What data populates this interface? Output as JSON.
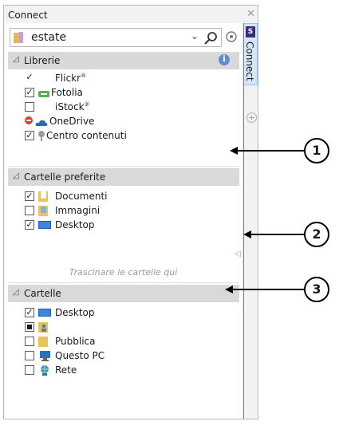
{
  "window": {
    "title": "Connect"
  },
  "search": {
    "value": "estate"
  },
  "sections": {
    "librerie": {
      "label": "Librerie",
      "items": [
        {
          "label": "Flickr",
          "sup": "®",
          "checked": true,
          "icon": "none"
        },
        {
          "label": "Fotolia",
          "sup": "",
          "checked": true,
          "icon": "fotolia-icon"
        },
        {
          "label": "iStock",
          "sup": "®",
          "checked": false,
          "icon": "none"
        },
        {
          "label": "OneDrive",
          "sup": "",
          "checked": null,
          "icon": "onedrive-icon"
        },
        {
          "label": "Centro contenuti",
          "sup": "",
          "checked": true,
          "icon": "content-center-icon"
        }
      ]
    },
    "preferite": {
      "label": "Cartelle preferite",
      "items": [
        {
          "label": "Documenti",
          "checked": true,
          "icon": "documents-folder-icon"
        },
        {
          "label": "Immagini",
          "checked": false,
          "icon": "pictures-folder-icon"
        },
        {
          "label": "Desktop",
          "checked": true,
          "icon": "desktop-icon"
        }
      ],
      "hint": "Trascinare le cartelle qui"
    },
    "cartelle": {
      "label": "Cartelle",
      "items": [
        {
          "label": "Desktop",
          "checked": true,
          "icon": "desktop-icon"
        },
        {
          "label": "",
          "checked": "indeterminate",
          "icon": "user-folder-icon"
        },
        {
          "label": "Pubblica",
          "checked": false,
          "icon": "folder-icon"
        },
        {
          "label": "Questo PC",
          "checked": false,
          "icon": "computer-icon"
        },
        {
          "label": "Rete",
          "checked": false,
          "icon": "network-icon"
        }
      ]
    }
  },
  "sidetab": {
    "label": "Connect"
  },
  "callouts": [
    "1",
    "2",
    "3"
  ],
  "colors": {
    "accent": "#2f93d8",
    "header": "#d9d9d9"
  }
}
